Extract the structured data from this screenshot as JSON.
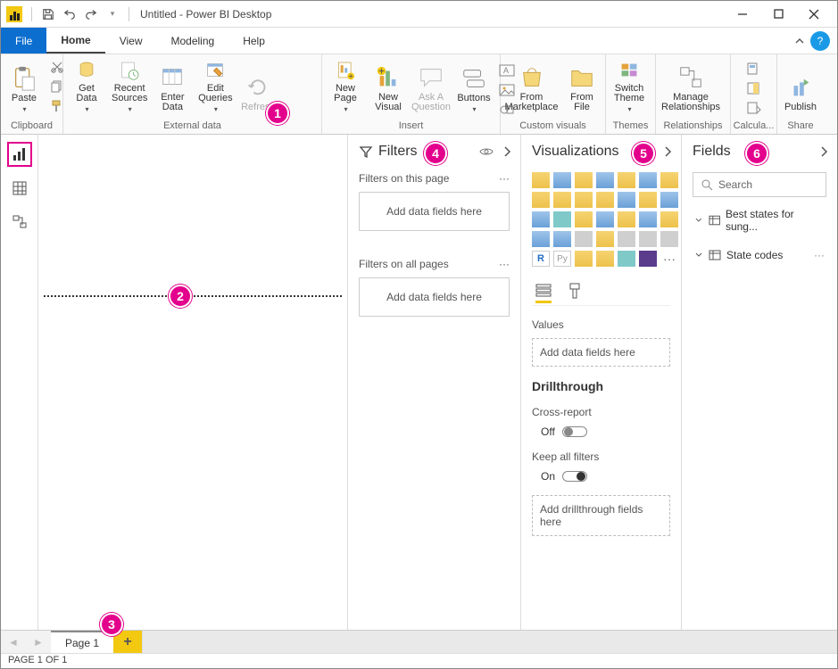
{
  "window": {
    "title": "Untitled - Power BI Desktop"
  },
  "menu": {
    "file": "File",
    "tabs": [
      "Home",
      "View",
      "Modeling",
      "Help"
    ],
    "active": "Home"
  },
  "ribbon": {
    "groups": {
      "clipboard": {
        "label": "Clipboard",
        "paste": "Paste"
      },
      "external_data": {
        "label": "External data",
        "get_data": "Get\nData",
        "recent_sources": "Recent\nSources",
        "enter_data": "Enter\nData",
        "edit_queries": "Edit\nQueries",
        "refresh": "Refresh"
      },
      "insert": {
        "label": "Insert",
        "new_page": "New\nPage",
        "new_visual": "New\nVisual",
        "ask_a_question": "Ask A\nQuestion",
        "buttons": "Buttons"
      },
      "custom_visuals": {
        "label": "Custom visuals",
        "from_marketplace": "From\nMarketplace",
        "from_file": "From\nFile"
      },
      "themes": {
        "label": "Themes",
        "switch_theme": "Switch\nTheme"
      },
      "relationships": {
        "label": "Relationships",
        "manage": "Manage\nRelationships"
      },
      "calculations": {
        "label": "Calcula..."
      },
      "share": {
        "label": "Share",
        "publish": "Publish"
      }
    }
  },
  "filters": {
    "title": "Filters",
    "on_page": "Filters on this page",
    "on_all": "Filters on all pages",
    "add": "Add data fields here",
    "more": "···"
  },
  "viz": {
    "title": "Visualizations",
    "values": "Values",
    "add": "Add data fields here",
    "drill": "Drillthrough",
    "cross": "Cross-report",
    "off": "Off",
    "keep": "Keep all filters",
    "on": "On",
    "drill_add": "Add drillthrough fields here"
  },
  "fields": {
    "title": "Fields",
    "search": "Search",
    "tables": [
      "Best states for sung...",
      "State codes"
    ]
  },
  "pages": {
    "tab1": "Page 1"
  },
  "status": {
    "text": "PAGE 1 OF 1"
  },
  "callouts": [
    "1",
    "2",
    "3",
    "4",
    "5",
    "6"
  ]
}
